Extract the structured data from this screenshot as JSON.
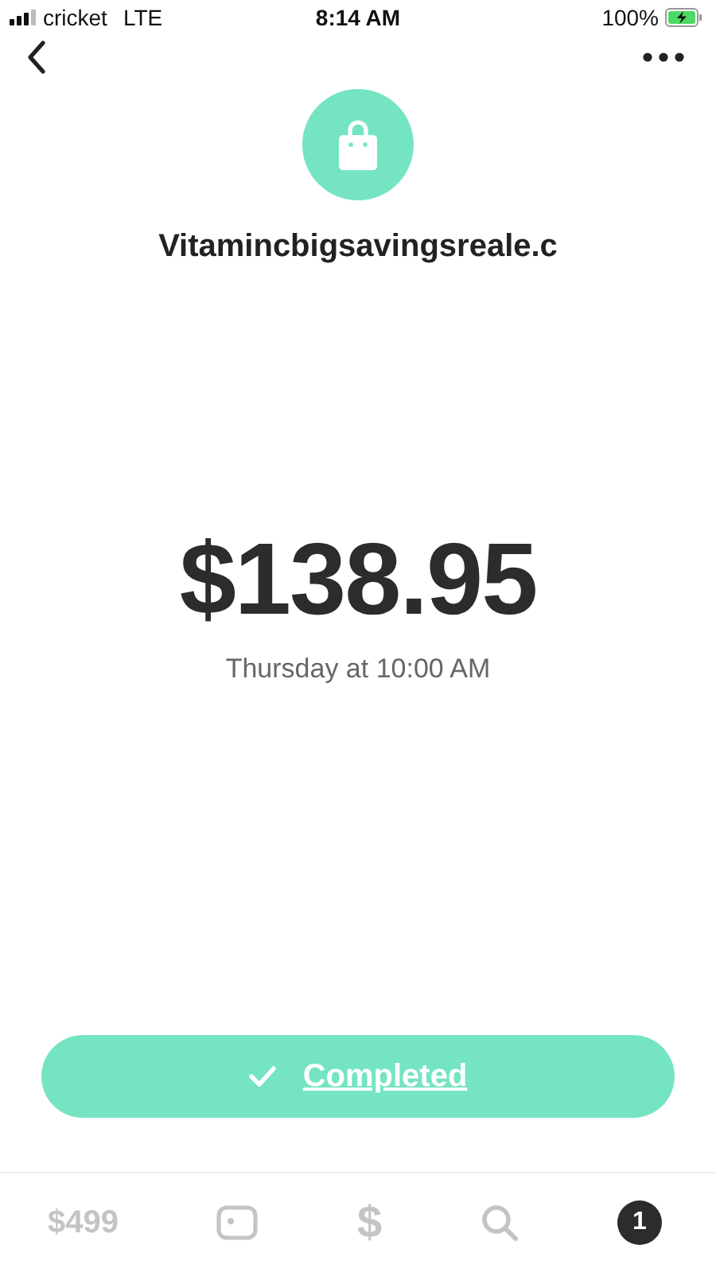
{
  "status_bar": {
    "carrier": "cricket",
    "network": "LTE",
    "time": "8:14 AM",
    "battery": "100%"
  },
  "merchant": {
    "name": "Vitamincbigsavingsreale.c"
  },
  "payment": {
    "amount": "$138.95",
    "date": "Thursday at 10:00 AM"
  },
  "status_button": {
    "label": "Completed",
    "checked": true
  },
  "tab_bar": [
    {
      "kind": "balance",
      "label": "$499"
    },
    {
      "kind": "card"
    },
    {
      "kind": "glyph",
      "label": "$"
    },
    {
      "kind": "search"
    },
    {
      "kind": "badge",
      "label": "1"
    }
  ]
}
